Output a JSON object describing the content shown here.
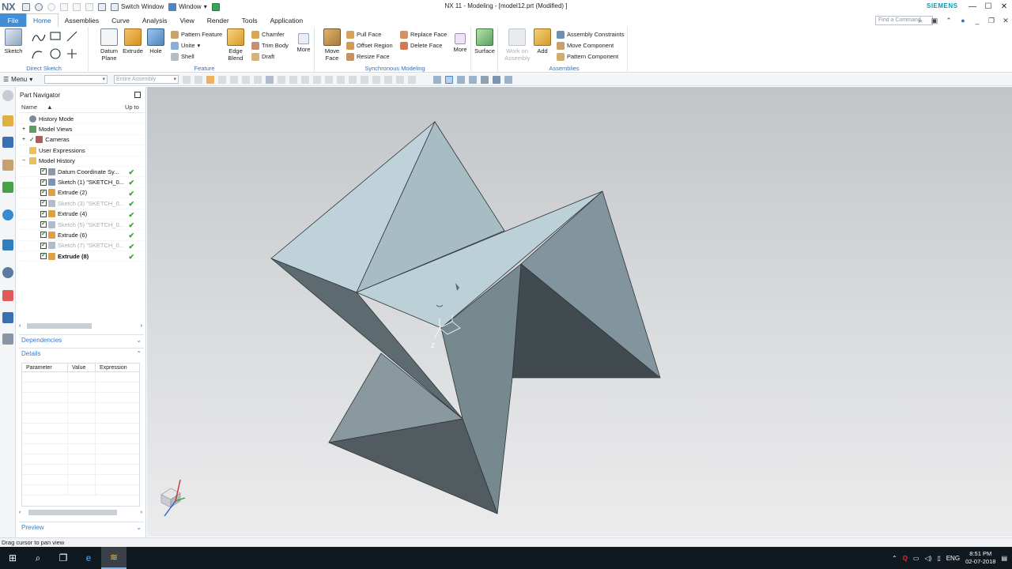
{
  "window": {
    "logo": "NX",
    "qat_switch": "Switch Window",
    "qat_window": "Window",
    "title": "NX 11 - Modeling - [model12.prt (Modified) ]",
    "brand": "SIEMENS",
    "brand_color": "#0a9aa9"
  },
  "tabs": [
    {
      "label": "File"
    },
    {
      "label": "Home"
    },
    {
      "label": "Assemblies"
    },
    {
      "label": "Curve"
    },
    {
      "label": "Analysis"
    },
    {
      "label": "View"
    },
    {
      "label": "Render"
    },
    {
      "label": "Tools"
    },
    {
      "label": "Application"
    }
  ],
  "command_finder": {
    "placeholder": "Find a Command"
  },
  "ribbon": {
    "direct_sketch": {
      "label": "Direct Sketch",
      "sketch": "Sketch"
    },
    "feature": {
      "label": "Feature",
      "datum_plane": "Datum Plane",
      "extrude": "Extrude",
      "hole": "Hole",
      "pattern_feature": "Pattern Feature",
      "unite": "Unite",
      "shell": "Shell",
      "edge_blend": "Edge Blend",
      "chamfer": "Chamfer",
      "trim_body": "Trim Body",
      "draft": "Draft",
      "more": "More"
    },
    "sync": {
      "label": "Synchronous Modeling",
      "move_face": "Move Face",
      "pull_face": "Pull Face",
      "offset_region": "Offset Region",
      "resize_face": "Resize Face",
      "replace_face": "Replace Face",
      "delete_face": "Delete Face",
      "more": "More"
    },
    "surface": {
      "label": "Surface"
    },
    "assemblies": {
      "label": "Assemblies",
      "work_on": "Work on Assembly",
      "add": "Add",
      "constraints": "Assembly Constraints",
      "move_component": "Move Component",
      "pattern_component": "Pattern Component"
    }
  },
  "selection_bar": {
    "menu": "Menu",
    "filter": "",
    "scope": "Entire Assembly"
  },
  "navigator": {
    "title": "Part Navigator",
    "col_name": "Name",
    "col_upto": "Up to",
    "items": [
      {
        "label": "History Mode"
      },
      {
        "label": "Model Views"
      },
      {
        "label": "Cameras"
      },
      {
        "label": "User Expressions"
      },
      {
        "label": "Model History"
      },
      {
        "label": "Datum Coordinate Sy..."
      },
      {
        "label": "Sketch (1) \"SKETCH_0..."
      },
      {
        "label": "Extrude (2)"
      },
      {
        "label": "Sketch (3) \"SKETCH_0..."
      },
      {
        "label": "Extrude (4)"
      },
      {
        "label": "Sketch (5) \"SKETCH_0..."
      },
      {
        "label": "Extrude (6)"
      },
      {
        "label": "Sketch (7) \"SKETCH_0..."
      },
      {
        "label": "Extrude (8)"
      }
    ],
    "dependencies": "Dependencies",
    "details": "Details",
    "details_cols": [
      "Parameter",
      "Value",
      "Expression"
    ],
    "preview": "Preview"
  },
  "viewport": {
    "triad_label": "Z"
  },
  "status": {
    "text": "Drag cursor to pan view"
  },
  "taskbar": {
    "lang": "ENG",
    "time": "8:51 PM",
    "date": "02-07-2018"
  }
}
